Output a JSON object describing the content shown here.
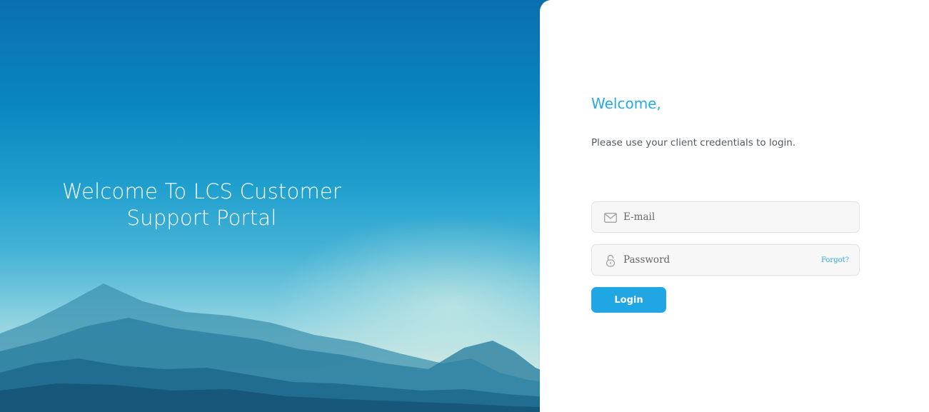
{
  "hero": {
    "title_line1": "Welcome To LCS Customer",
    "title_line2": "Support Portal"
  },
  "login": {
    "heading": "Welcome,",
    "subtitle": "Please use your client credentials to login.",
    "email": {
      "placeholder": "E-mail",
      "value": "",
      "icon": "envelope-icon"
    },
    "password": {
      "placeholder": "Password",
      "value": "",
      "icon": "lock-icon",
      "forgot_label": "Forgot?"
    },
    "submit_label": "Login"
  },
  "colors": {
    "accent": "#27a9e1",
    "button": "#1fa6e3",
    "field_bg": "#f7f7f7"
  }
}
